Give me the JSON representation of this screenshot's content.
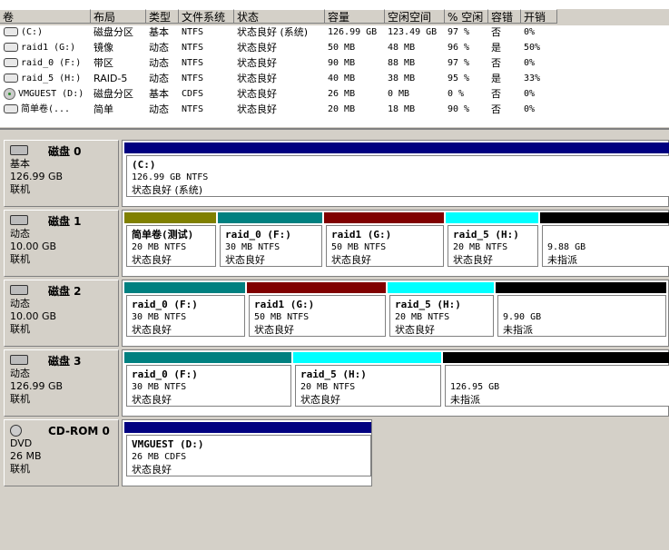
{
  "columns": [
    "卷",
    "布局",
    "类型",
    "文件系统",
    "状态",
    "容量",
    "空闲空间",
    "% 空闲",
    "容错",
    "开销"
  ],
  "volumes": [
    {
      "name": "(C:)",
      "layout": "磁盘分区",
      "type": "基本",
      "fs": "NTFS",
      "status": "状态良好 (系统)",
      "capacity": "126.99 GB",
      "free": "123.49 GB",
      "pct": "97 %",
      "ft": "否",
      "overhead": "0%",
      "icon": "disk-icon"
    },
    {
      "name": "raid1 (G:)",
      "layout": "镜像",
      "type": "动态",
      "fs": "NTFS",
      "status": "状态良好",
      "capacity": "50 MB",
      "free": "48 MB",
      "pct": "96 %",
      "ft": "是",
      "overhead": "50%",
      "icon": "disk-icon"
    },
    {
      "name": "raid_0 (F:)",
      "layout": "带区",
      "type": "动态",
      "fs": "NTFS",
      "status": "状态良好",
      "capacity": "90 MB",
      "free": "88 MB",
      "pct": "97 %",
      "ft": "否",
      "overhead": "0%",
      "icon": "disk-icon"
    },
    {
      "name": "raid_5 (H:)",
      "layout": "RAID-5",
      "type": "动态",
      "fs": "NTFS",
      "status": "状态良好",
      "capacity": "40 MB",
      "free": "38 MB",
      "pct": "95 %",
      "ft": "是",
      "overhead": "33%",
      "icon": "disk-icon"
    },
    {
      "name": "VMGUEST (D:)",
      "layout": "磁盘分区",
      "type": "基本",
      "fs": "CDFS",
      "status": "状态良好",
      "capacity": "26 MB",
      "free": "0 MB",
      "pct": "0 %",
      "ft": "否",
      "overhead": "0%",
      "icon": "cd-icon"
    },
    {
      "name": "简单卷(...",
      "layout": "简单",
      "type": "动态",
      "fs": "NTFS",
      "status": "状态良好",
      "capacity": "20 MB",
      "free": "18 MB",
      "pct": "90 %",
      "ft": "否",
      "overhead": "0%",
      "icon": "disk-icon"
    }
  ],
  "disks": [
    {
      "title": "磁盘 0",
      "type": "基本",
      "size": "126.99 GB",
      "state": "联机",
      "parts": [
        {
          "name": "(C:)",
          "size": "126.99 GB NTFS",
          "status": "状态良好 (系统)",
          "color": "#000080"
        }
      ]
    },
    {
      "title": "磁盘 1",
      "type": "动态",
      "size": "10.00 GB",
      "state": "联机",
      "parts": [
        {
          "name": "简单卷(测试)",
          "size": "20 MB NTFS",
          "status": "状态良好",
          "color": "#808000"
        },
        {
          "name": "raid_0  (F:)",
          "size": "30 MB NTFS",
          "status": "状态良好",
          "color": "#008080"
        },
        {
          "name": "raid1  (G:)",
          "size": "50 MB NTFS",
          "status": "状态良好",
          "color": "#800000"
        },
        {
          "name": "raid_5  (H:)",
          "size": "20 MB NTFS",
          "status": "状态良好",
          "color": "#00ffff"
        },
        {
          "name": "",
          "size": "9.88 GB",
          "status": "未指派",
          "color": "#000000"
        }
      ]
    },
    {
      "title": "磁盘 2",
      "type": "动态",
      "size": "10.00 GB",
      "state": "联机",
      "parts": [
        {
          "name": "raid_0  (F:)",
          "size": "30 MB NTFS",
          "status": "状态良好",
          "color": "#008080"
        },
        {
          "name": "raid1  (G:)",
          "size": "50 MB NTFS",
          "status": "状态良好",
          "color": "#800000"
        },
        {
          "name": "raid_5  (H:)",
          "size": "20 MB NTFS",
          "status": "状态良好",
          "color": "#00ffff"
        },
        {
          "name": "",
          "size": "9.90 GB",
          "status": "未指派",
          "color": "#000000"
        }
      ]
    },
    {
      "title": "磁盘 3",
      "type": "动态",
      "size": "126.99 GB",
      "state": "联机",
      "parts": [
        {
          "name": "raid_0  (F:)",
          "size": "30 MB NTFS",
          "status": "状态良好",
          "color": "#008080"
        },
        {
          "name": "raid_5  (H:)",
          "size": "20 MB NTFS",
          "status": "状态良好",
          "color": "#00ffff"
        },
        {
          "name": "",
          "size": "126.95 GB",
          "status": "未指派",
          "color": "#000000"
        }
      ]
    },
    {
      "title": "CD-ROM 0",
      "type": "DVD",
      "size": "26 MB",
      "state": "联机",
      "parts": [
        {
          "name": "VMGUEST  (D:)",
          "size": "26 MB CDFS",
          "status": "状态良好",
          "color": "#000080"
        }
      ]
    }
  ]
}
